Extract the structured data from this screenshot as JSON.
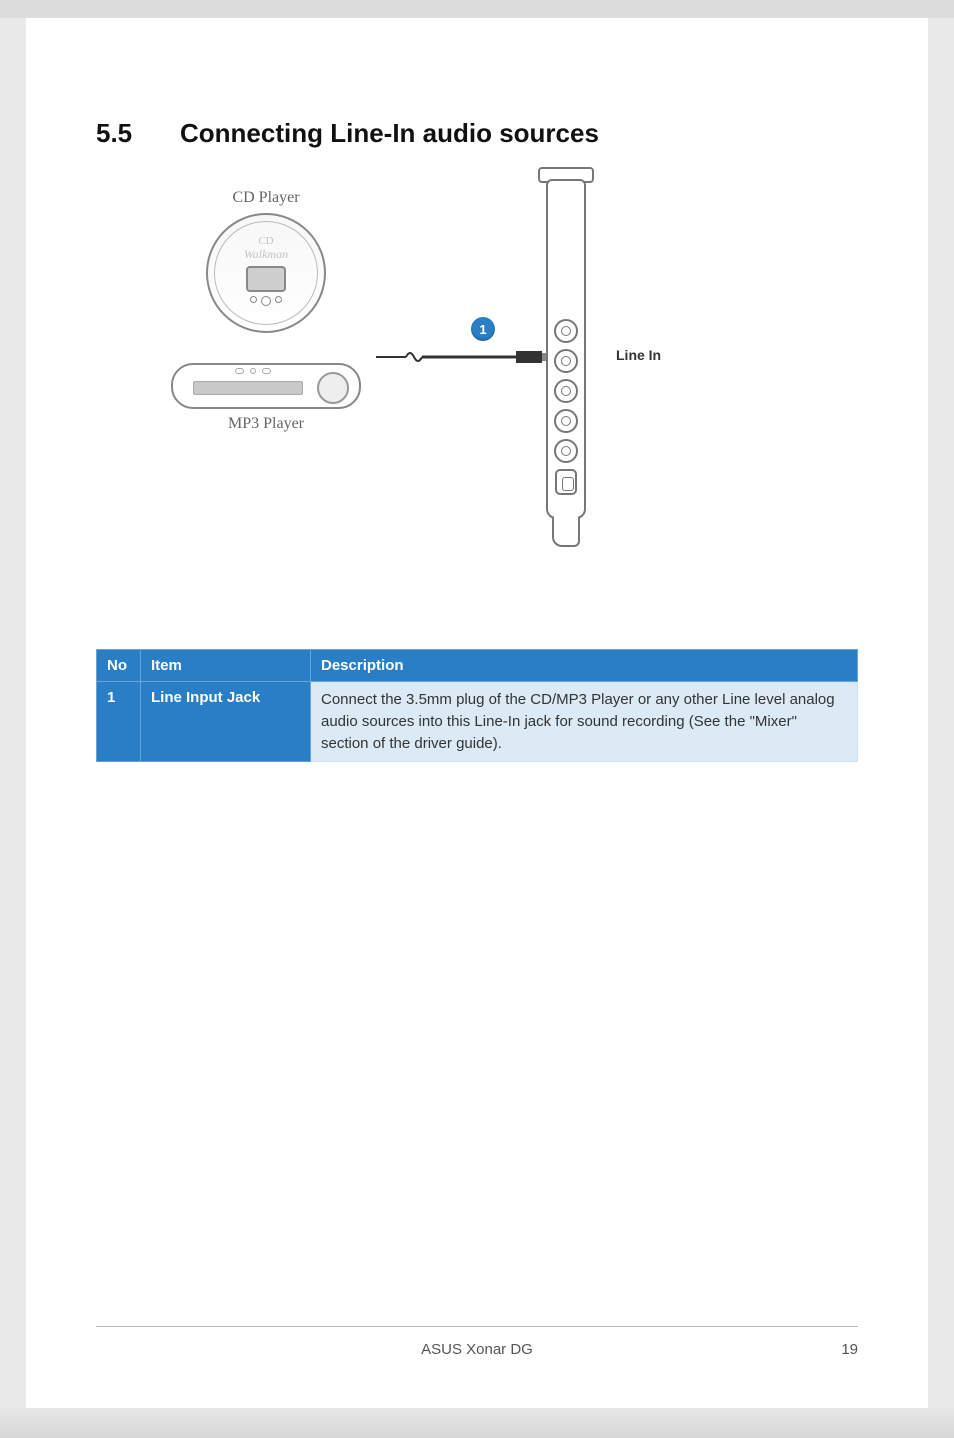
{
  "section": {
    "number": "5.5",
    "title": "Connecting Line-In audio sources"
  },
  "diagram": {
    "cd_label": "CD Player",
    "cd_brand_top": "CD",
    "cd_brand": "Walkman",
    "mp3_label": "MP3 Player",
    "callout_num": "1",
    "linein_label": "Line In"
  },
  "table": {
    "headers": {
      "no": "No",
      "item": "Item",
      "desc": "Description"
    },
    "rows": [
      {
        "no": "1",
        "item": "Line Input Jack",
        "desc": "Connect the 3.5mm plug of the CD/MP3 Player or any other Line level analog audio sources into this Line-In jack for sound recording (See the \"Mixer\" section of the driver guide)."
      }
    ]
  },
  "footer": {
    "product": "ASUS Xonar DG",
    "page": "19"
  }
}
